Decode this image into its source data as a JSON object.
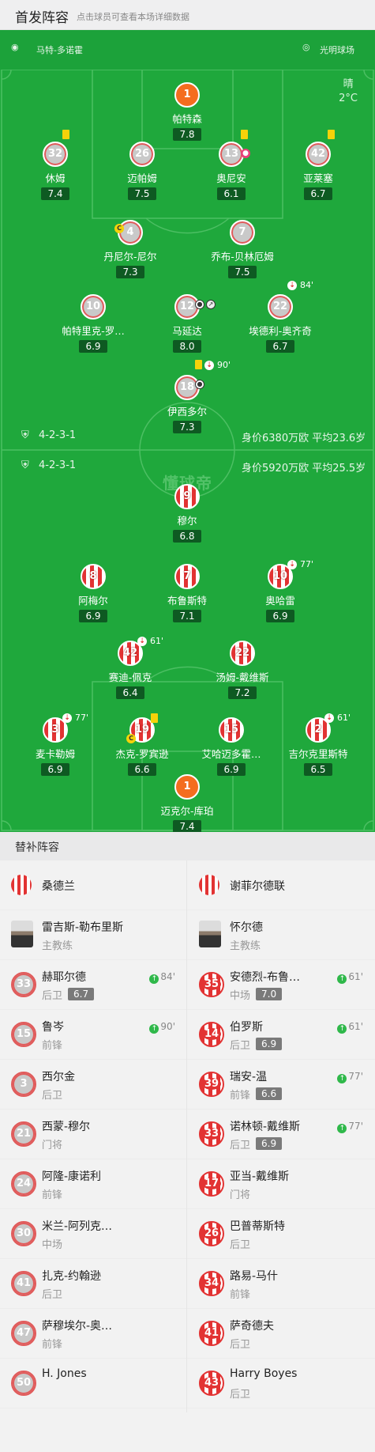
{
  "header": {
    "title": "首发阵容",
    "subtitle": "点击球员可查看本场详细数据"
  },
  "match": {
    "referee": "马特-多诺霍",
    "stadium": "光明球场",
    "weather": "晴",
    "temperature": "2°C",
    "watermark": "懂球帝"
  },
  "home_team": {
    "name": "谢菲尔德联",
    "formation": "4-2-3-1",
    "value_text": "身价5920万欧 平均25.5岁"
  },
  "away_team": {
    "name": "桑德兰",
    "formation": "4-2-3-1",
    "value_text": "身价6380万欧 平均23.6岁"
  },
  "top_players": [
    {
      "num": "1",
      "name": "帕特森",
      "rating": "7.8"
    },
    {
      "num": "32",
      "name": "休姆",
      "rating": "7.4"
    },
    {
      "num": "26",
      "name": "迈帕姆",
      "rating": "7.5"
    },
    {
      "num": "13",
      "name": "奥尼安",
      "rating": "6.1"
    },
    {
      "num": "42",
      "name": "亚莱塞",
      "rating": "6.7"
    },
    {
      "num": "4",
      "name": "丹尼尔-尼尔",
      "rating": "7.3"
    },
    {
      "num": "7",
      "name": "乔布-贝林厄姆",
      "rating": "7.5"
    },
    {
      "num": "10",
      "name": "帕特里克-罗…",
      "rating": "6.9"
    },
    {
      "num": "12",
      "name": "马延达",
      "rating": "8.0"
    },
    {
      "num": "22",
      "name": "埃德利-奥齐奇",
      "rating": "6.7"
    },
    {
      "num": "18",
      "name": "伊西多尔",
      "rating": "7.3"
    }
  ],
  "bottom_players": [
    {
      "num": "9",
      "name": "穆尔",
      "rating": "6.8"
    },
    {
      "num": "8",
      "name": "阿梅尔",
      "rating": "6.9"
    },
    {
      "num": "7",
      "name": "布鲁斯特",
      "rating": "7.1"
    },
    {
      "num": "10",
      "name": "奥哈雷",
      "rating": "6.9"
    },
    {
      "num": "42",
      "name": "赛迪-佩克",
      "rating": "6.4"
    },
    {
      "num": "22",
      "name": "汤姆-戴维斯",
      "rating": "7.2"
    },
    {
      "num": "3",
      "name": "麦卡勒姆",
      "rating": "6.9"
    },
    {
      "num": "19",
      "name": "杰克-罗宾逊",
      "rating": "6.6"
    },
    {
      "num": "15",
      "name": "艾哈迈多霍…",
      "rating": "6.9"
    },
    {
      "num": "2",
      "name": "吉尔克里斯特",
      "rating": "6.5"
    },
    {
      "num": "1",
      "name": "迈克尔-库珀",
      "rating": "7.4"
    }
  ],
  "events": {
    "ozichi": "84'",
    "isidor": "90'",
    "ohare": "77'",
    "peck": "61'",
    "mccallum": "77'",
    "gilchrist": "61'"
  },
  "subs_title": "替补阵容",
  "left_subs": [
    {
      "team": "桑德兰"
    },
    {
      "name": "雷吉斯-勒布里斯",
      "pos": "主教练"
    },
    {
      "num": "33",
      "name": "赫耶尔德",
      "pos": "后卫",
      "rating": "6.7",
      "time": "84'"
    },
    {
      "num": "15",
      "name": "鲁岑",
      "pos": "前锋",
      "time": "90'"
    },
    {
      "num": "3",
      "name": "西尔金",
      "pos": "后卫"
    },
    {
      "num": "21",
      "name": "西蒙-穆尔",
      "pos": "门将"
    },
    {
      "num": "24",
      "name": "阿隆-康诺利",
      "pos": "前锋"
    },
    {
      "num": "30",
      "name": "米兰-阿列克…",
      "pos": "中场"
    },
    {
      "num": "41",
      "name": "扎克-约翰逊",
      "pos": "后卫"
    },
    {
      "num": "47",
      "name": "萨穆埃尔-奥…",
      "pos": "前锋"
    },
    {
      "num": "50",
      "name": "H. Jones",
      "pos": ""
    }
  ],
  "right_subs": [
    {
      "team": "谢菲尔德联"
    },
    {
      "name": "怀尔德",
      "pos": "主教练"
    },
    {
      "num": "35",
      "name": "安德烈-布鲁…",
      "pos": "中场",
      "rating": "7.0",
      "time": "61'"
    },
    {
      "num": "14",
      "name": "伯罗斯",
      "pos": "后卫",
      "rating": "6.9",
      "time": "61'"
    },
    {
      "num": "39",
      "name": "瑞安-温",
      "pos": "前锋",
      "rating": "6.6",
      "time": "77'"
    },
    {
      "num": "33",
      "name": "诺林顿-戴维斯",
      "pos": "后卫",
      "rating": "6.9",
      "time": "77'"
    },
    {
      "num": "17",
      "name": "亚当-戴维斯",
      "pos": "门将"
    },
    {
      "num": "26",
      "name": "巴普蒂斯特",
      "pos": "后卫"
    },
    {
      "num": "34",
      "name": "路易-马什",
      "pos": "前锋"
    },
    {
      "num": "41",
      "name": "萨奇德夫",
      "pos": "后卫"
    },
    {
      "num": "43",
      "name": "Harry Boyes",
      "pos": "后卫"
    }
  ],
  "colors": {
    "pitch": "#1fa83c",
    "gk": "#f46d1f",
    "stripe_red": "#e23333",
    "rating_bg": "#0e5a22"
  }
}
